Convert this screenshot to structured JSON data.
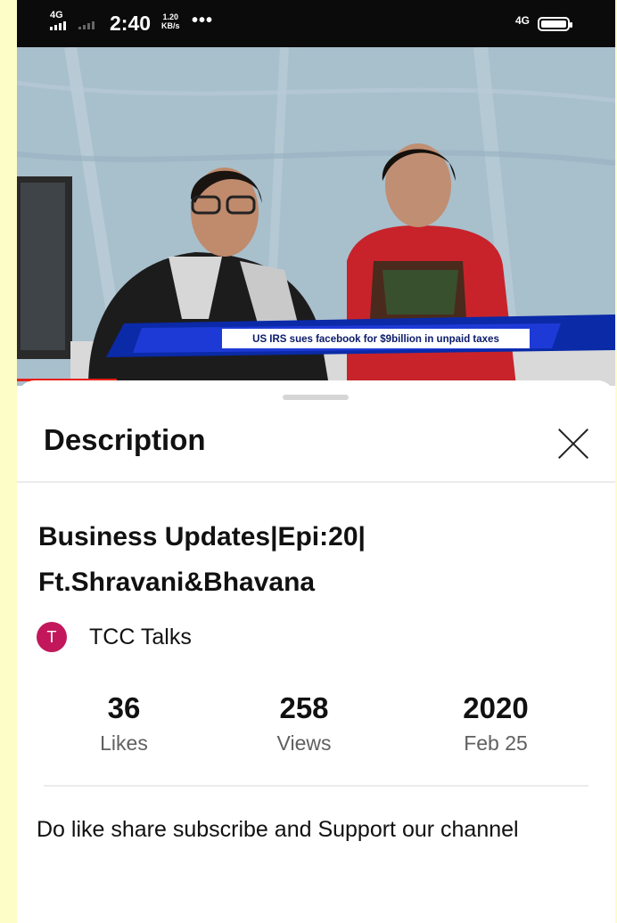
{
  "status_bar": {
    "network": "4G",
    "time": "2:40",
    "speed_value": "1.20",
    "speed_unit": "KB/s",
    "more_dots": "•••",
    "right_network": "4G"
  },
  "video": {
    "news_ticker": "US IRS sues facebook for $9billion in unpaid taxes"
  },
  "sheet": {
    "title": "Description",
    "video_title_line1": "Business Updates|Epi:20|",
    "video_title_line2": "Ft.Shravani&Bhavana",
    "channel_initial": "T",
    "channel_name": "TCC Talks",
    "stats": {
      "likes_value": "36",
      "likes_label": "Likes",
      "views_value": "258",
      "views_label": "Views",
      "year_value": "2020",
      "date_label": "Feb 25"
    },
    "description": "Do like share subscribe and Support our channel"
  },
  "colors": {
    "accent_avatar": "#c2185b",
    "progress_red": "#e62117",
    "background_outer": "#fdfdc8"
  }
}
